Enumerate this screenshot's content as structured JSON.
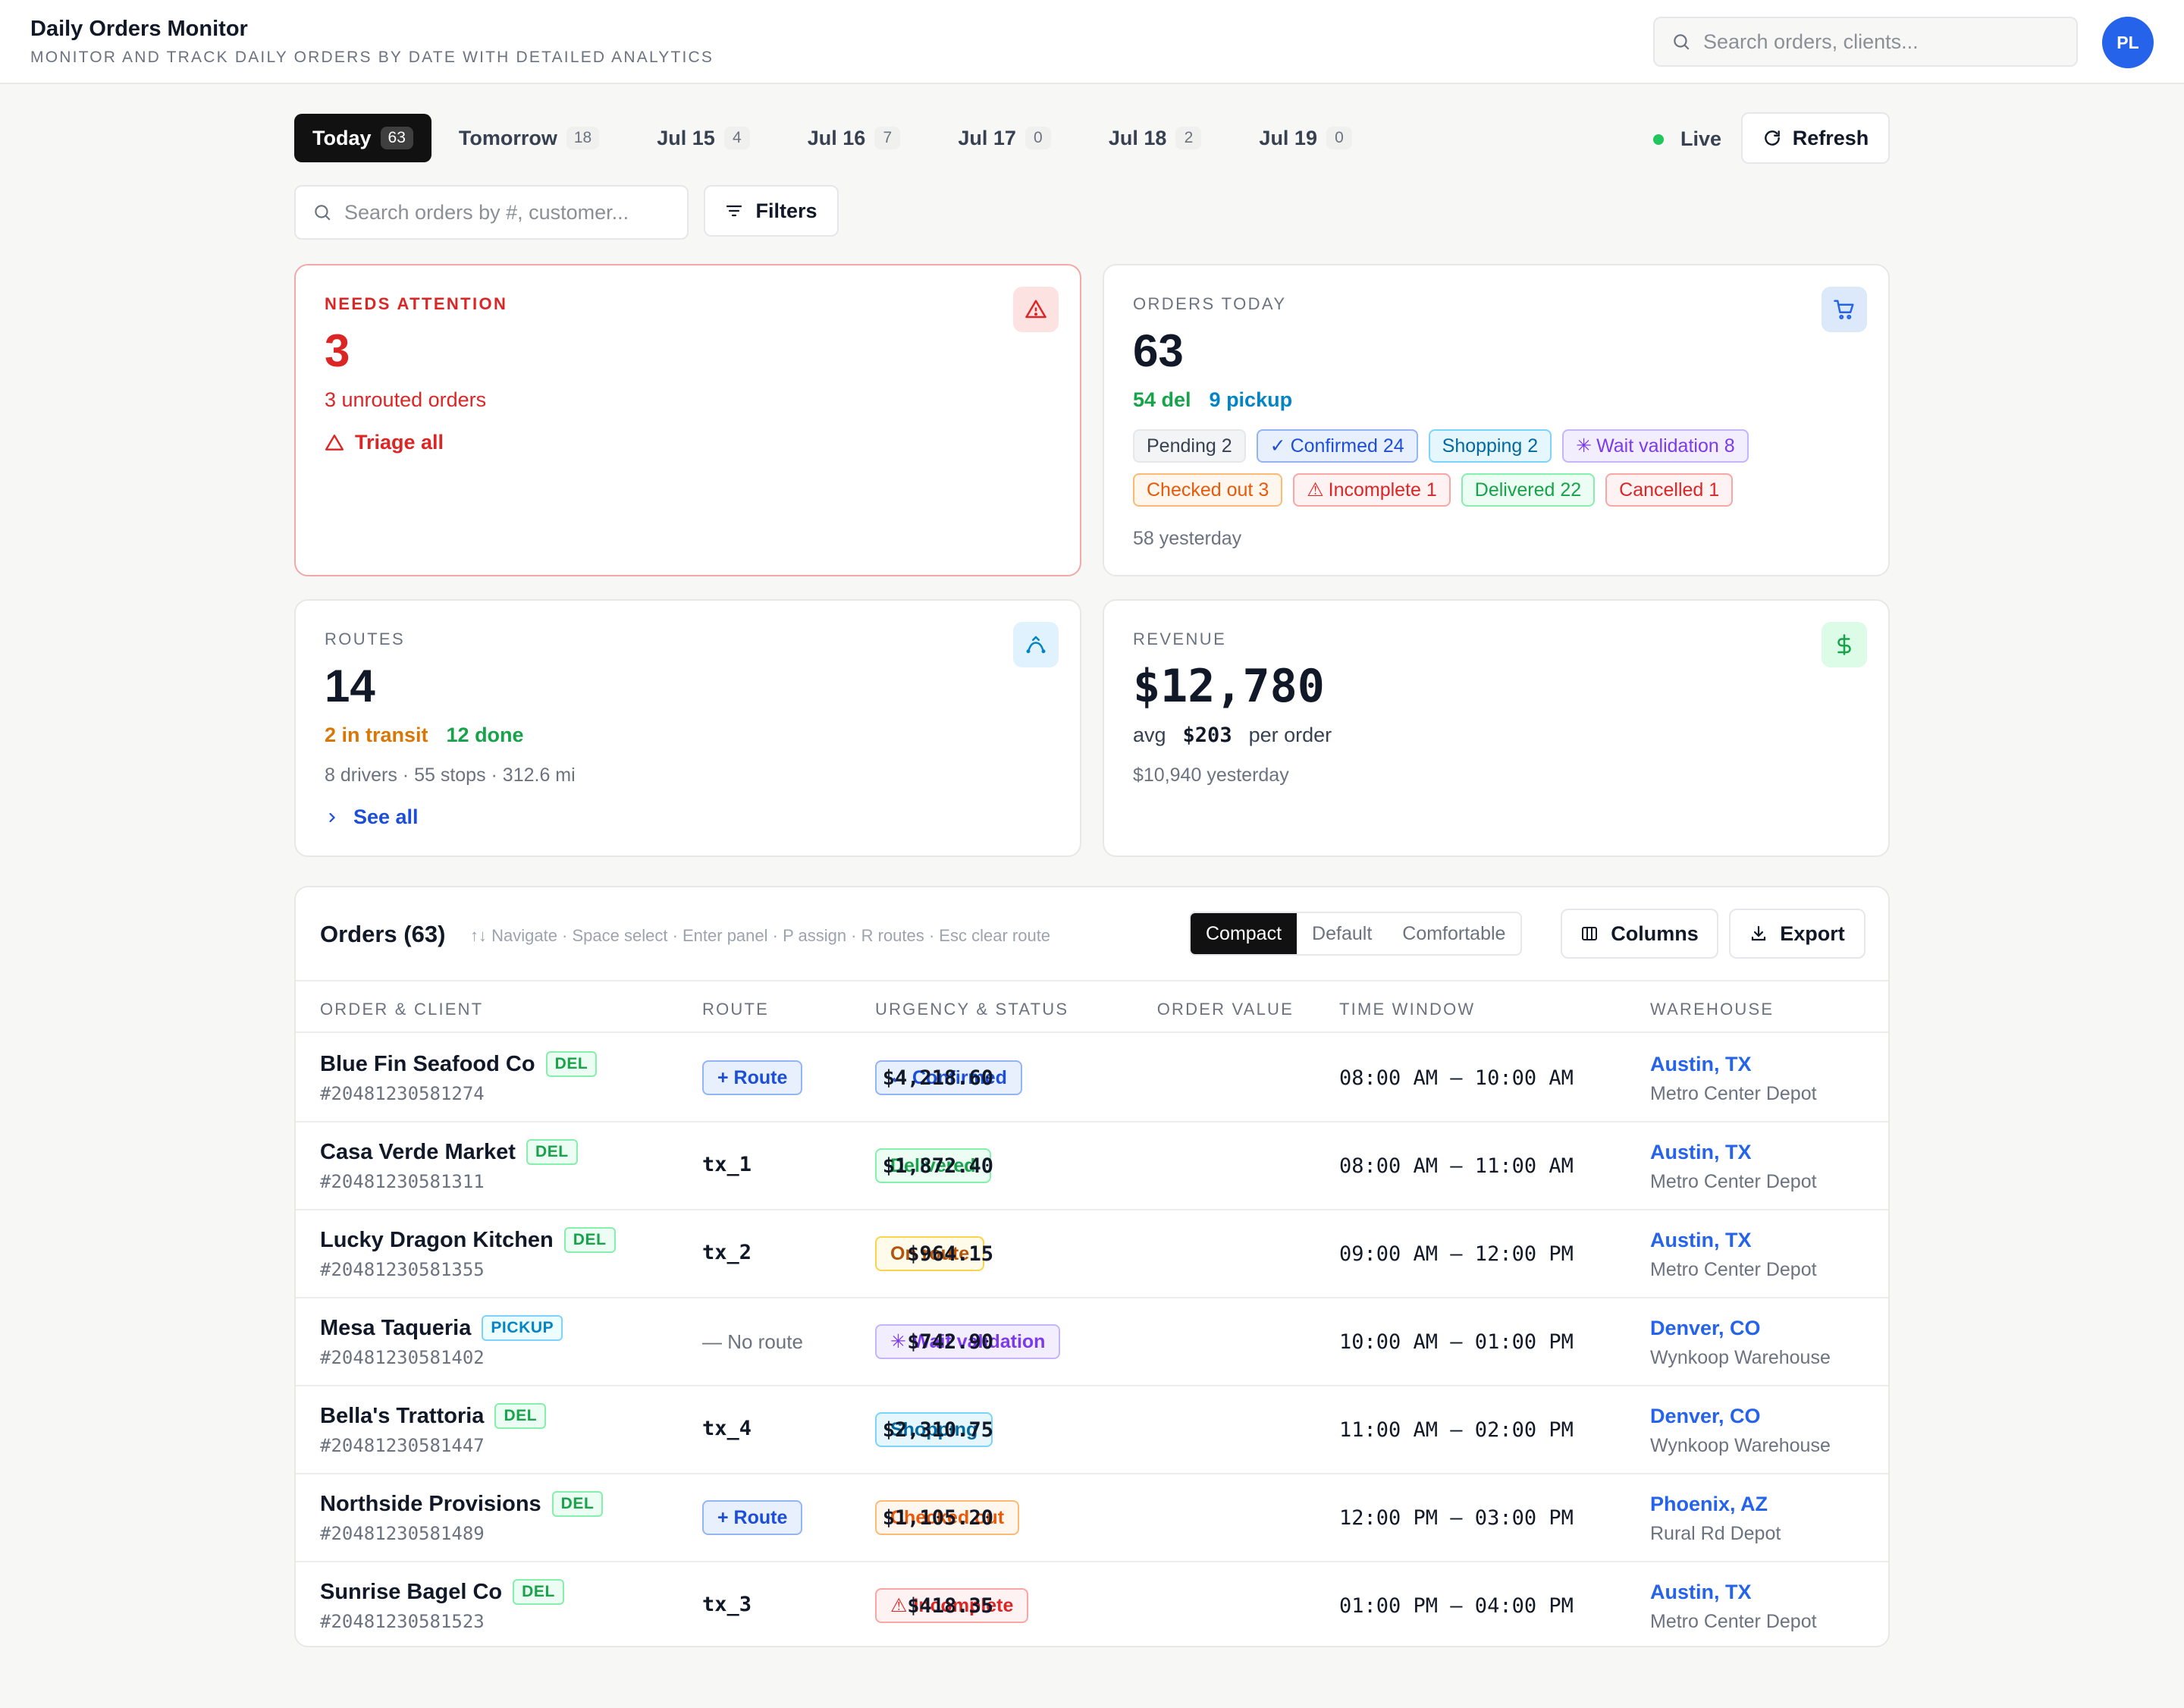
{
  "header": {
    "title": "Daily Orders Monitor",
    "subtitle": "MONITOR AND TRACK DAILY ORDERS BY DATE WITH DETAILED ANALYTICS",
    "search_placeholder": "Search orders, clients...",
    "avatar_initials": "PL"
  },
  "date_tabs": [
    {
      "label": "Today",
      "count": "63",
      "active": true
    },
    {
      "label": "Tomorrow",
      "count": "18"
    },
    {
      "label": "Jul 15",
      "count": "4"
    },
    {
      "label": "Jul 16",
      "count": "7"
    },
    {
      "label": "Jul 17",
      "count": "0"
    },
    {
      "label": "Jul 18",
      "count": "2"
    },
    {
      "label": "Jul 19",
      "count": "0"
    }
  ],
  "live_label": "Live",
  "refresh_label": "Refresh",
  "order_search_placeholder": "Search orders by #, customer...",
  "filters_label": "Filters",
  "cards": {
    "attention": {
      "label": "NEEDS ATTENTION",
      "value": "3",
      "detail": "3 unrouted orders",
      "action": "Triage all",
      "color": "#dc2626"
    },
    "orders_today": {
      "label": "ORDERS TODAY",
      "value": "63",
      "delivery": "54 del",
      "pickup": "9 pickup",
      "statuses": [
        {
          "label": "Pending 2",
          "bg": "#f3f4f6",
          "border": "#e5e7eb",
          "color": "#374151",
          "icon": ""
        },
        {
          "label": "Confirmed 24",
          "bg": "#e8f0fe",
          "border": "#93b4f5",
          "color": "#1d4ed8",
          "icon": "✓"
        },
        {
          "label": "Shopping 2",
          "bg": "#e6f6fd",
          "border": "#7dd3fc",
          "color": "#0369a1",
          "icon": ""
        },
        {
          "label": "Wait validation 8",
          "bg": "#f3eefe",
          "border": "#c4b5fd",
          "color": "#7c3aed",
          "icon": "✳"
        },
        {
          "label": "Checked out 3",
          "bg": "#fff7ed",
          "border": "#fdba74",
          "color": "#ea580c",
          "icon": ""
        },
        {
          "label": "Incomplete 1",
          "bg": "#fef2f2",
          "border": "#fca5a5",
          "color": "#dc2626",
          "icon": "⚠"
        },
        {
          "label": "Delivered 22",
          "bg": "#ecfdf3",
          "border": "#86efac",
          "color": "#16a34a",
          "icon": ""
        },
        {
          "label": "Cancelled 1",
          "bg": "#fef2f2",
          "border": "#fca5a5",
          "color": "#dc2626",
          "icon": ""
        }
      ],
      "yesterday": "58 yesterday"
    },
    "routes": {
      "label": "ROUTES",
      "value": "14",
      "in_transit": "2 in transit",
      "done": "12 done",
      "detail": "8 drivers · 55 stops · 312.6 mi",
      "action": "See all"
    },
    "revenue": {
      "label": "REVENUE",
      "value": "$12,780",
      "avg_prefix": "avg",
      "avg_value": "$203",
      "avg_suffix": "per order",
      "yesterday": "$10,940 yesterday"
    }
  },
  "orders": {
    "title": "Orders (63)",
    "hint": "↑↓ Navigate · Space select · Enter panel · P assign · R routes · Esc clear route",
    "density": [
      "Compact",
      "Default",
      "Comfortable"
    ],
    "columns_label": "Columns",
    "export_label": "Export",
    "headers": [
      "ORDER & CLIENT",
      "ROUTE",
      "URGENCY & STATUS",
      "ORDER VALUE",
      "TIME WINDOW",
      "WAREHOUSE"
    ],
    "rows": [
      {
        "client": "Blue Fin Seafood Co",
        "type": "DEL",
        "id": "#20481230581274",
        "route": "+ Route",
        "route_kind": "button",
        "status": "Confirmed",
        "status_icon": "✓",
        "status_kind": "confirmed",
        "value": "$4,218.60",
        "window": "08:00 AM — 10:00 AM",
        "city": "Austin, TX",
        "warehouse": "Metro Center Depot"
      },
      {
        "client": "Casa Verde Market",
        "type": "DEL",
        "id": "#20481230581311",
        "route": "tx_1",
        "route_kind": "text",
        "status": "Delivered",
        "status_icon": "",
        "status_kind": "delivered",
        "value": "$1,872.40",
        "window": "08:00 AM — 11:00 AM",
        "city": "Austin, TX",
        "warehouse": "Metro Center Depot"
      },
      {
        "client": "Lucky Dragon Kitchen",
        "type": "DEL",
        "id": "#20481230581355",
        "route": "tx_2",
        "route_kind": "text",
        "status": "On route",
        "status_icon": "",
        "status_kind": "onroute",
        "value": "$964.15",
        "window": "09:00 AM — 12:00 PM",
        "city": "Austin, TX",
        "warehouse": "Metro Center Depot"
      },
      {
        "client": "Mesa Taqueria",
        "type": "PICKUP",
        "id": "#20481230581402",
        "route": "— No route",
        "route_kind": "none",
        "status": "Wait validation",
        "status_icon": "✳",
        "status_kind": "wait",
        "value": "$742.90",
        "window": "10:00 AM — 01:00 PM",
        "city": "Denver, CO",
        "warehouse": "Wynkoop Warehouse"
      },
      {
        "client": "Bella's Trattoria",
        "type": "DEL",
        "id": "#20481230581447",
        "route": "tx_4",
        "route_kind": "text",
        "status": "Shopping",
        "status_icon": "",
        "status_kind": "shopping",
        "value": "$2,310.75",
        "window": "11:00 AM — 02:00 PM",
        "city": "Denver, CO",
        "warehouse": "Wynkoop Warehouse"
      },
      {
        "client": "Northside Provisions",
        "type": "DEL",
        "id": "#20481230581489",
        "route": "+ Route",
        "route_kind": "button",
        "status": "Checked out",
        "status_icon": "",
        "status_kind": "checkedout",
        "value": "$1,105.20",
        "window": "12:00 PM — 03:00 PM",
        "city": "Phoenix, AZ",
        "warehouse": "Rural Rd Depot"
      },
      {
        "client": "Sunrise Bagel Co",
        "type": "DEL",
        "id": "#20481230581523",
        "route": "tx_3",
        "route_kind": "text",
        "status": "Incomplete",
        "status_icon": "⚠",
        "status_kind": "incomplete",
        "value": "$418.35",
        "window": "01:00 PM — 04:00 PM",
        "city": "Austin, TX",
        "warehouse": "Metro Center Depot"
      }
    ]
  },
  "status_styles": {
    "confirmed": {
      "bg": "#e8f0fe",
      "border": "#93b4f5",
      "color": "#1d4ed8"
    },
    "delivered": {
      "bg": "#ecfdf3",
      "border": "#86efac",
      "color": "#16a34a"
    },
    "onroute": {
      "bg": "#fffbeb",
      "border": "#fcd34d",
      "color": "#b45309"
    },
    "wait": {
      "bg": "#f3eefe",
      "border": "#c4b5fd",
      "color": "#7c3aed"
    },
    "shopping": {
      "bg": "#e6f6fd",
      "border": "#7dd3fc",
      "color": "#0369a1"
    },
    "checkedout": {
      "bg": "#fff7ed",
      "border": "#fdba74",
      "color": "#ea580c"
    },
    "incomplete": {
      "bg": "#fef2f2",
      "border": "#fca5a5",
      "color": "#dc2626"
    }
  }
}
